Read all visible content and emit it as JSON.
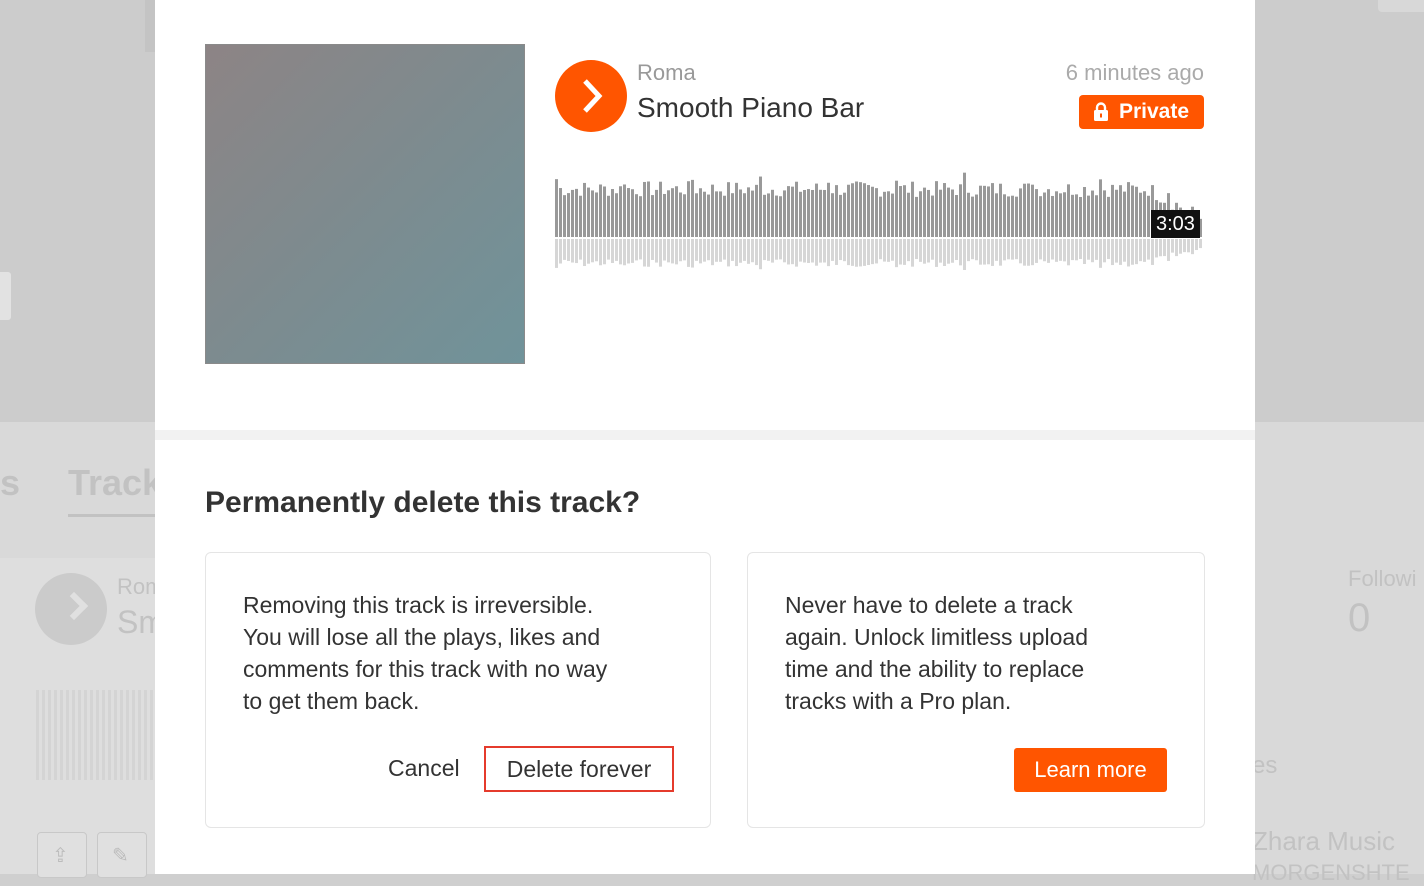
{
  "background": {
    "tab_partial": "s",
    "tab_tracks": "Track",
    "artist_partial": "Rom",
    "title_partial": "Sm",
    "followers_label": "Followi",
    "followers_count": "0",
    "side_partial": "es",
    "side_name": "Zhara Music",
    "side_sub": "MORGENSHTE"
  },
  "track": {
    "artist": "Roma",
    "title": "Smooth Piano Bar",
    "time_ago": "6 minutes ago",
    "privacy_label": "Private",
    "duration": "3:03",
    "accent_color": "#ff5500"
  },
  "dialog": {
    "heading": "Permanently delete this track?",
    "warning_text": "Removing this track is irreversible.\nYou will lose all the plays, likes and\ncomments for this track with no way\nto get them back.",
    "cancel_label": "Cancel",
    "delete_label": "Delete forever",
    "promo_text": "Never have to delete a track\nagain. Unlock limitless upload\ntime and the ability to replace\ntracks with a Pro plan.",
    "learn_more_label": "Learn more"
  },
  "icons": [
    "play-icon",
    "lock-icon",
    "share-icon",
    "pencil-icon"
  ]
}
